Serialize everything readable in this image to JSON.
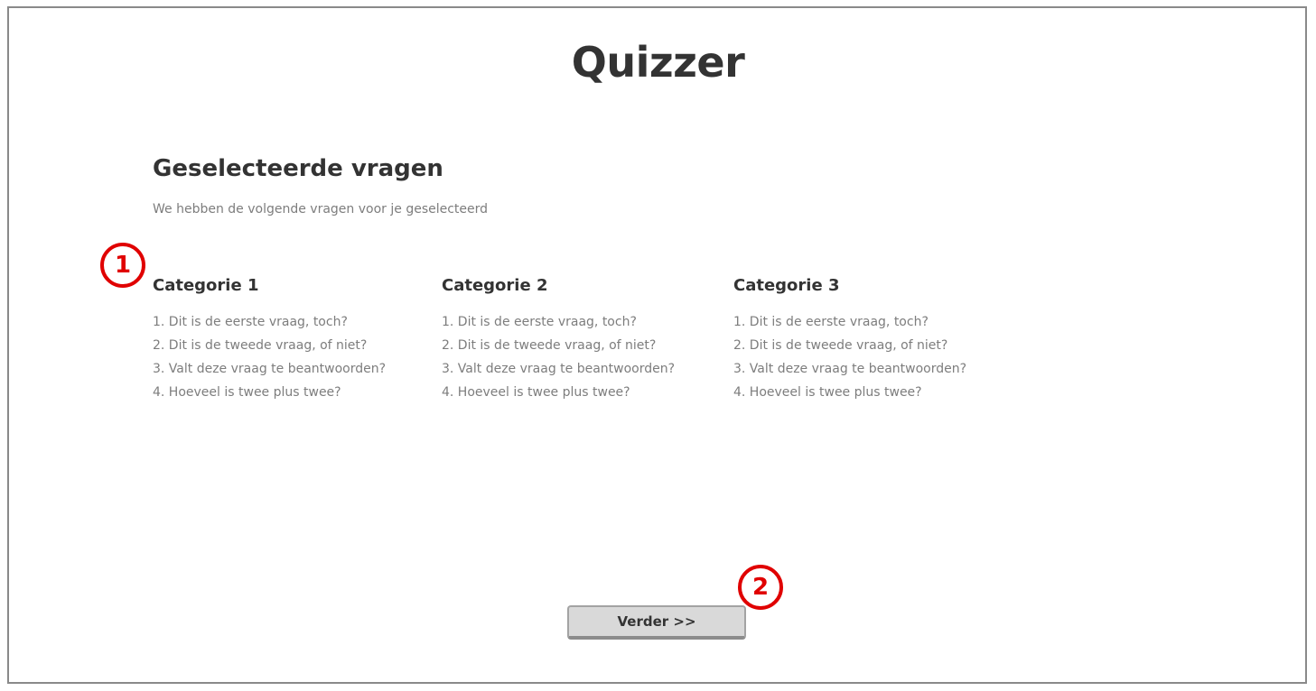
{
  "app": {
    "title": "Quizzer"
  },
  "section": {
    "title": "Geselecteerde vragen",
    "subtitle": "We hebben de volgende vragen voor je geselecteerd"
  },
  "categories": [
    {
      "title": "Categorie 1",
      "questions": [
        "1. Dit is de eerste vraag, toch?",
        "2. Dit is de tweede vraag, of niet?",
        "3. Valt deze vraag te beantwoorden?",
        "4. Hoeveel is twee plus twee?"
      ]
    },
    {
      "title": "Categorie 2",
      "questions": [
        "1. Dit is de eerste vraag, toch?",
        "2. Dit is de tweede vraag, of niet?",
        "3. Valt deze vraag te beantwoorden?",
        "4. Hoeveel is twee plus twee?"
      ]
    },
    {
      "title": "Categorie 3",
      "questions": [
        "1. Dit is de eerste vraag, toch?",
        "2. Dit is de tweede vraag, of niet?",
        "3. Valt deze vraag te beantwoorden?",
        "4. Hoeveel is twee plus twee?"
      ]
    }
  ],
  "annotations": [
    "1",
    "2"
  ],
  "actions": {
    "next_label": "Verder >>"
  },
  "colors": {
    "annotation_red": "#e00000",
    "heading_text": "#333333",
    "muted_text": "#7d7d7d",
    "button_bg": "#d9d9d9",
    "frame_border": "#8a8a8a"
  }
}
